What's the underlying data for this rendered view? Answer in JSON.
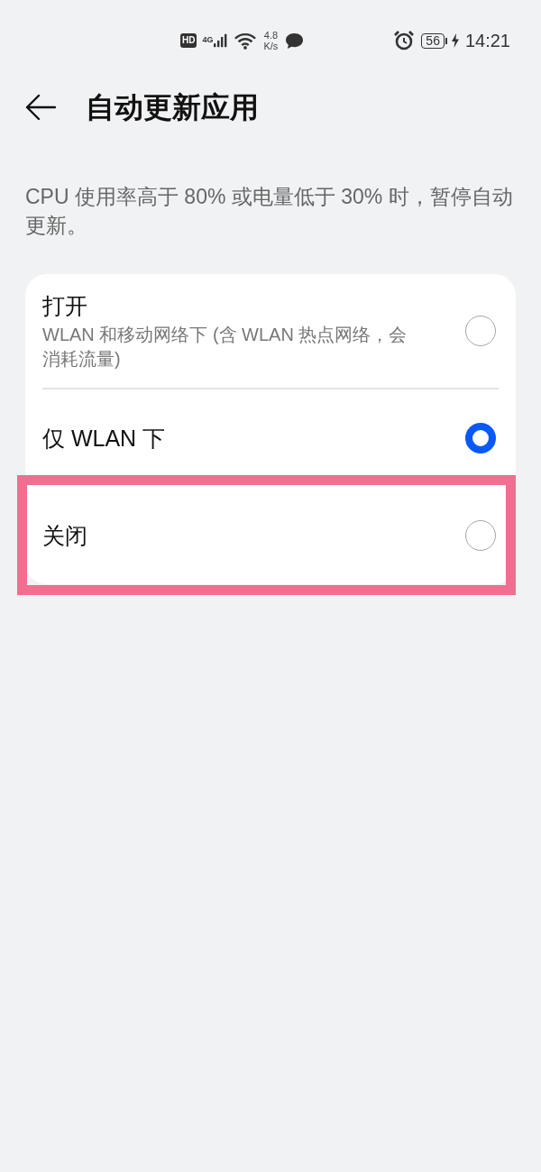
{
  "status_bar": {
    "hd_badge": "HD",
    "network_type": "4G",
    "speed_value": "4.8",
    "speed_unit": "K/s",
    "battery_percent": "56",
    "charging": true,
    "time": "14:21"
  },
  "header": {
    "title": "自动更新应用"
  },
  "description": "CPU 使用率高于 80% 或电量低于 30% 时，暂停自动更新。",
  "options": [
    {
      "label": "打开",
      "subtitle": "WLAN 和移动网络下 (含 WLAN 热点网络，会消耗流量)",
      "selected": false,
      "highlighted": false
    },
    {
      "label": "仅 WLAN 下",
      "selected": true,
      "highlighted": false
    },
    {
      "label": "关闭",
      "selected": false,
      "highlighted": true
    }
  ]
}
